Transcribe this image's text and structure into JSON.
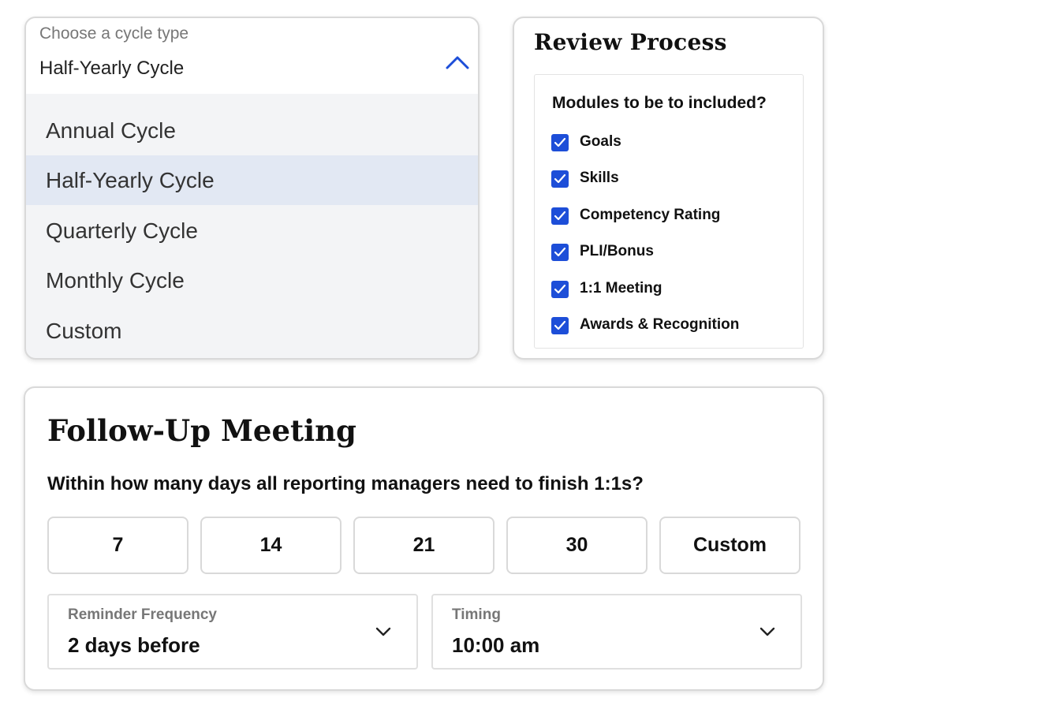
{
  "cycle": {
    "label": "Choose a cycle type",
    "value": "Half-Yearly Cycle",
    "options": [
      "Annual Cycle",
      "Half-Yearly Cycle",
      "Quarterly Cycle",
      "Monthly Cycle",
      "Custom"
    ],
    "selected_index": 1
  },
  "review": {
    "title": "Review Process",
    "question": "Modules to be to included?",
    "modules": [
      {
        "label": "Goals",
        "checked": true
      },
      {
        "label": "Skills",
        "checked": true
      },
      {
        "label": "Competency Rating",
        "checked": true
      },
      {
        "label": "PLI/Bonus",
        "checked": true
      },
      {
        "label": "1:1 Meeting",
        "checked": true
      },
      {
        "label": "Awards & Recognition",
        "checked": true
      }
    ]
  },
  "follow_up": {
    "title": "Follow-Up Meeting",
    "question": "Within how many days all reporting managers need to finish 1:1s?",
    "day_options": [
      "7",
      "14",
      "21",
      "30",
      "Custom"
    ],
    "reminder": {
      "label": "Reminder Frequency",
      "value": "2 days before"
    },
    "timing": {
      "label": "Timing",
      "value": "10:00 am"
    }
  },
  "colors": {
    "accent": "#1d4ed8",
    "selected_bg": "#e2e8f3"
  }
}
